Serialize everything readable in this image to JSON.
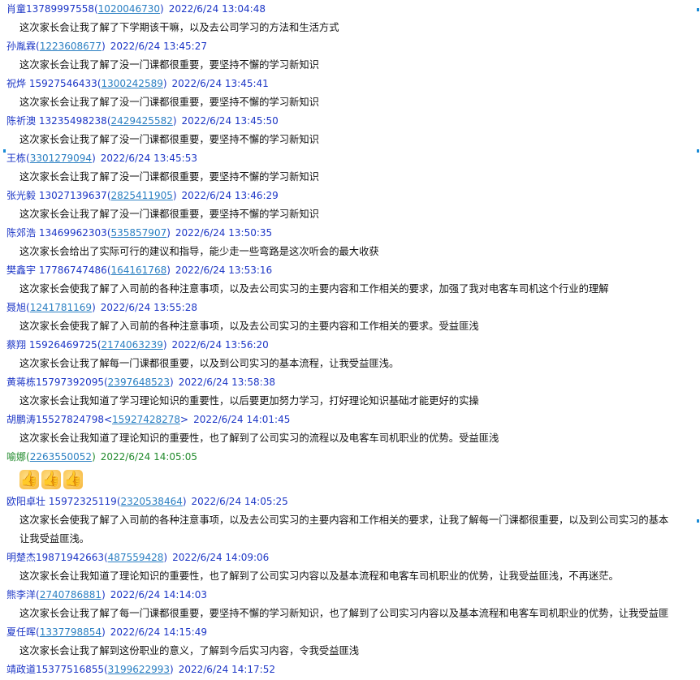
{
  "messages": [
    {
      "name": "肖童13789997558",
      "qq": "1020046730",
      "time": "2022/6/24 13:04:48",
      "text": "这次家长会让我了解了下学期该干嘛，以及去公司学习的方法和生活方式"
    },
    {
      "name": "孙胤霖",
      "qq": "1223608677",
      "time": "2022/6/24 13:45:27",
      "text": "这次家长会让我了解了没一门课都很重要，要坚持不懈的学习新知识"
    },
    {
      "name": "祝烨 15927546433",
      "qq": "1300242589",
      "time": "2022/6/24 13:45:41",
      "text": "这次家长会让我了解了没一门课都很重要，要坚持不懈的学习新知识"
    },
    {
      "name": "陈祈澳 13235498238",
      "qq": "2429425582",
      "time": "2022/6/24 13:45:50",
      "text": "这次家长会让我了解了没一门课都很重要，要坚持不懈的学习新知识"
    },
    {
      "name": "王栋",
      "qq": "3301279094",
      "time": "2022/6/24 13:45:53",
      "text": "这次家长会让我了解了没一门课都很重要，要坚持不懈的学习新知识"
    },
    {
      "name": "张光毅 13027139637",
      "qq": "2825411905",
      "time": "2022/6/24 13:46:29",
      "text": "这次家长会让我了解了没一门课都很重要，要坚持不懈的学习新知识"
    },
    {
      "name": "陈郊浩 13469962303",
      "qq": "535857907",
      "time": "2022/6/24 13:50:35",
      "text": "这次家长会给出了实际可行的建议和指导，能少走一些弯路是这次听会的最大收获"
    },
    {
      "name": "樊鑫宇  17786747486",
      "qq": "164161768",
      "time": "2022/6/24 13:53:16",
      "text": "这次家长会使我了解了入司前的各种注意事项，以及去公司实习的主要内容和工作相关的要求，加强了我对电客车司机这个行业的理解"
    },
    {
      "name": "聂旭",
      "qq": "1241781169",
      "time": "2022/6/24 13:55:28",
      "text": "这次家长会使我了解了入司前的各种注意事项，以及去公司实习的主要内容和工作相关的要求。受益匪浅"
    },
    {
      "name": "蔡翔 15926469725",
      "qq": "2174063239",
      "time": "2022/6/24 13:56:20",
      "text": "这次家长会让我了解每一门课都很重要，以及到公司实习的基本流程，让我受益匪浅。"
    },
    {
      "name": "黄蒋栋15797392095",
      "qq": "2397648523",
      "time": "2022/6/24 13:58:38",
      "text": "这次家长会让我知道了学习理论知识的重要性，以后要更加努力学习，打好理论知识基础才能更好的实操"
    },
    {
      "name": "胡鹏涛15527824798<",
      "qq": "15927428278",
      "name_suffix": ">",
      "time": "2022/6/24 14:01:45",
      "text": "这次家长会让我知道了理论知识的重要性，也了解到了公司实习的流程以及电客车司机职业的优势。受益匪浅"
    },
    {
      "name": "喻娜",
      "qq": "2263550052",
      "time": "2022/6/24 14:05:05",
      "emoji": [
        "👍",
        "👍",
        "👍"
      ],
      "green": true
    },
    {
      "name": "欧阳卓壮 15972325119",
      "qq": "2320538464",
      "time": "2022/6/24 14:05:25",
      "text": "这次家长会使我了解了入司前的各种注意事项，以及去公司实习的主要内容和工作相关的要求，让我了解每一门课都很重要，以及到公司实习的基本",
      "text2": "让我受益匪浅。"
    },
    {
      "name": "明楚杰19871942663",
      "qq": "487559428",
      "time": "2022/6/24 14:09:06",
      "text": "这次家长会让我知道了理论知识的重要性，也了解到了公司实习内容以及基本流程和电客车司机职业的优势，让我受益匪浅，不再迷茫。"
    },
    {
      "name": "熊李洋",
      "qq": "2740786881",
      "time": "2022/6/24 14:14:03",
      "text": "这次家长会让我了解了每一门课都很重要，要坚持不懈的学习新知识，也了解到了公司实习内容以及基本流程和电客车司机职业的优势，让我受益匪"
    },
    {
      "name": "夏任晖",
      "qq": "1337798854",
      "time": "2022/6/24 14:15:49",
      "text": "这次家长会让我了解到这份职业的意义，了解到今后实习内容，令我受益匪浅"
    },
    {
      "name": "靖政道15377516855",
      "qq": "3199622993",
      "time": "2022/6/24 14:17:52"
    }
  ]
}
